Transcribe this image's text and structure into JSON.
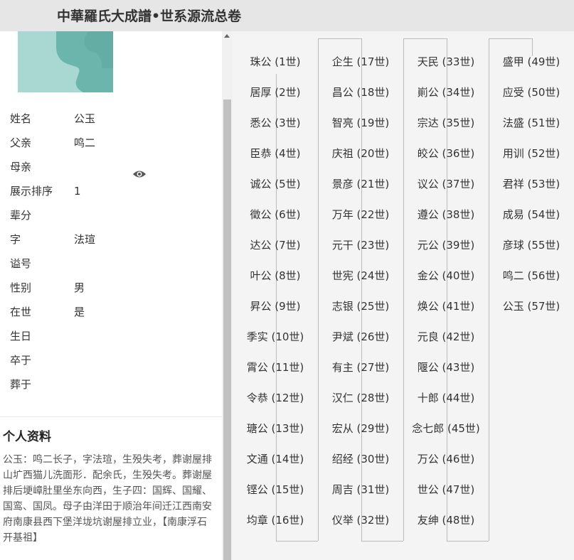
{
  "header": {
    "title": "中華羅氏大成譜•世系源流总卷"
  },
  "profile": {
    "fields": [
      {
        "label": "姓名",
        "value": "公玉"
      },
      {
        "label": "父亲",
        "value": "鸣二"
      },
      {
        "label": "母亲",
        "value": ""
      },
      {
        "label": "展示排序",
        "value": "1"
      },
      {
        "label": "辈分",
        "value": ""
      },
      {
        "label": "字",
        "value": "法瑄"
      },
      {
        "label": "谥号",
        "value": ""
      },
      {
        "label": "性别",
        "value": "男"
      },
      {
        "label": "在世",
        "value": "是"
      },
      {
        "label": "生日",
        "value": ""
      },
      {
        "label": "卒于",
        "value": ""
      },
      {
        "label": "葬于",
        "value": ""
      }
    ]
  },
  "bio": {
    "heading": "个人资料",
    "text": "公玉：鸣二长子，字法瑄，生殁失考，葬谢屋排山圹西猫儿洗面形．配余氏，生殁失考。葬谢屋排后埂嶂肚里坐东向西，生子四：国辉、国耀、国鸾、国凤。母子由洋田于顺治年间迁江西南安府南康县西下堡洋垅坑谢屋排立业，【南康浮石开基祖】"
  },
  "generations": [
    [
      "珠公 (1世)",
      "居厚 (2世)",
      "悉公 (3世)",
      "臣恭 (4世)",
      "诚公 (5世)",
      "徵公 (6世)",
      "达公 (7世)",
      "叶公 (8世)",
      "昇公 (9世)",
      "季实 (10世)",
      "霄公 (11世)",
      "令恭 (12世)",
      "瑭公 (13世)",
      "文通 (14世)",
      "铿公 (15世)",
      "均章 (16世)"
    ],
    [
      "企生 (17世)",
      "昌公 (18世)",
      "智亮 (19世)",
      "庆祖 (20世)",
      "景彦 (21世)",
      "万年 (22世)",
      "元干 (23世)",
      "世宪 (24世)",
      "志银 (25世)",
      "尹斌 (26世)",
      "有主 (27世)",
      "汉仁 (28世)",
      "宏从 (29世)",
      "绍经 (30世)",
      "周吉 (31世)",
      "仪举 (32世)"
    ],
    [
      "天民 (33世)",
      "崱公 (34世)",
      "宗达 (35世)",
      "皎公 (36世)",
      "议公 (37世)",
      "遵公 (38世)",
      "元公 (39世)",
      "金公 (40世)",
      "焕公 (41世)",
      "元良 (42世)",
      "隁公 (43世)",
      "十郎 (44世)",
      "念七郎 (45世)",
      "万公 (46世)",
      "世公 (47世)",
      "友绅 (48世)"
    ],
    [
      "盛甲 (49世)",
      "应受 (50世)",
      "法盛 (51世)",
      "用训 (52世)",
      "君祥 (53世)",
      "成易 (54世)",
      "彦球 (55世)",
      "鸣二 (56世)",
      "公玉 (57世)"
    ]
  ],
  "colors": {
    "avatar_bg": "#a9d8d2",
    "avatar_figure": "#6bb5ac",
    "panel_bg": "#f4f4f4",
    "header_bg": "#e6e6e6"
  },
  "icons": {
    "avatar": "person-silhouette",
    "view": "eye-icon"
  }
}
